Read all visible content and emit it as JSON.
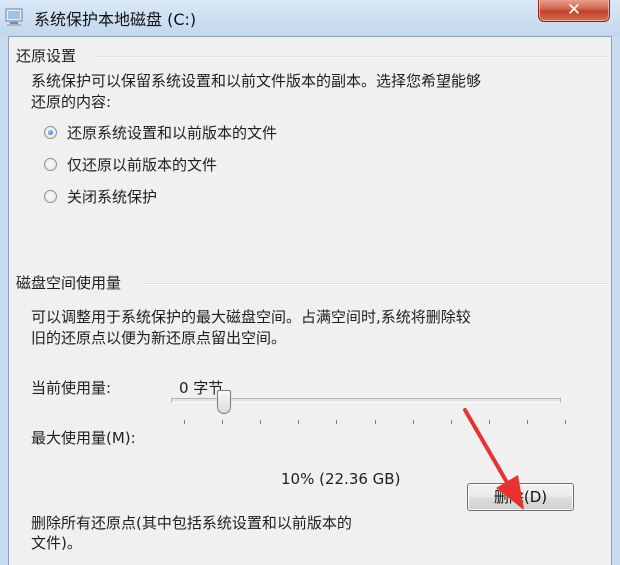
{
  "window": {
    "title": "系统保护本地磁盘 (C:)"
  },
  "restore_section": {
    "title": "还原设置",
    "description_line1": "系统保护可以保留系统设置和以前文件版本的副本。选择您希望能够",
    "description_line2": "还原的内容:",
    "options": [
      {
        "label": "还原系统设置和以前版本的文件",
        "selected": true
      },
      {
        "label": "仅还原以前版本的文件",
        "selected": false
      },
      {
        "label": "关闭系统保护",
        "selected": false
      }
    ]
  },
  "disk_section": {
    "title": "磁盘空间使用量",
    "description_line1": "可以调整用于系统保护的最大磁盘空间。占满空间时,系统将删除较",
    "description_line2": "旧的还原点以便为新还原点留出空间。",
    "current_usage_label": "当前使用量:",
    "current_usage_value": "0 字节",
    "max_usage_label": "最大使用量(M):",
    "max_usage_fraction": 0.1,
    "max_usage_value": "10% (22.36 GB)",
    "delete_text_line1": "删除所有还原点(其中包括系统设置和以前版本的",
    "delete_text_line2": "文件)。",
    "delete_button": "删除(D)"
  },
  "colors": {
    "annotation_arrow": "#e8322f",
    "close_button": "#c7482f"
  }
}
